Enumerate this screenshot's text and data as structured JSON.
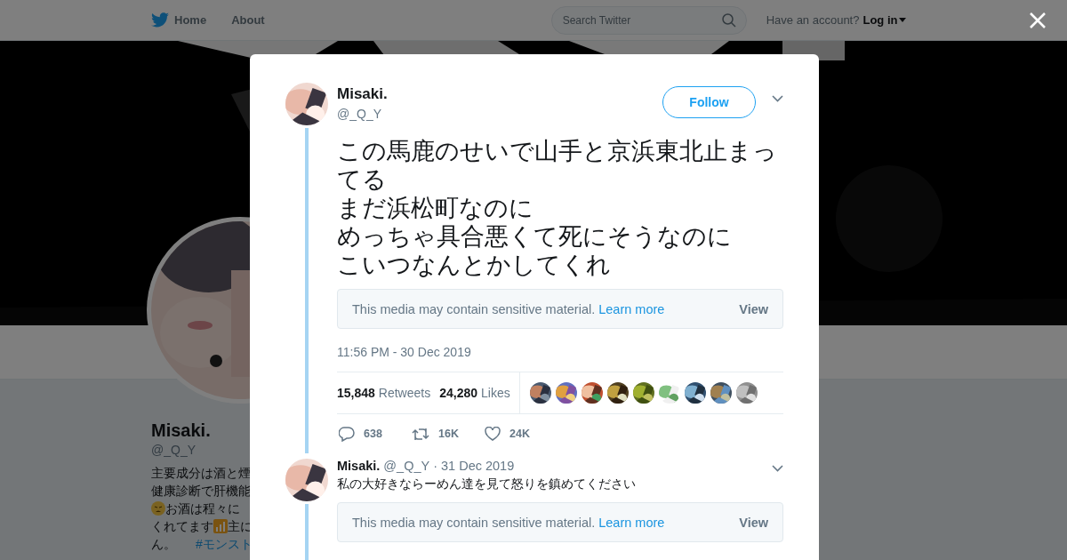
{
  "background": {
    "nav": {
      "items": [
        {
          "label": "Home",
          "kind": "bird"
        },
        {
          "label": "About",
          "kind": "plain"
        }
      ],
      "search": {
        "placeholder": "Search Twitter"
      },
      "account_prompt": "Have an account?",
      "login": "Log in"
    },
    "profile": {
      "name": "Misaki.",
      "handle": "@_Q_Y",
      "bio": [
        [
          {
            "kind": "text",
            "text": "主要成分は酒と煙"
          }
        ],
        [
          {
            "kind": "text",
            "text": "健康診断で肝機能"
          }
        ],
        [
          {
            "kind": "face"
          },
          {
            "kind": "text",
            "text": " お酒は程々に"
          }
        ],
        [
          {
            "kind": "text",
            "text": "くれてます"
          },
          {
            "kind": "bars"
          },
          {
            "kind": "text",
            "text": "主に"
          }
        ],
        [
          {
            "kind": "text",
            "text": "ん。"
          },
          {
            "kind": "link",
            "text": "#モンスト"
          }
        ]
      ]
    }
  },
  "dialog": {
    "tweet": {
      "name": "Misaki.",
      "handle": "@_Q_Y",
      "follow": "Follow",
      "lines": [
        "この馬鹿のせいで山手と京浜東北止まってる",
        "まだ浜松町なのに",
        "めっちゃ具合悪くて死にそうなのに",
        "こいつなんとかしてくれ"
      ],
      "media_notice": {
        "text": "This media may contain sensitive material.",
        "link": "Learn more",
        "button": "View"
      },
      "time": "11:56 PM - 30 Dec 2019",
      "stats": [
        {
          "count": "15,848",
          "label": "Retweets"
        },
        {
          "count": "24,280",
          "label": "Likes"
        }
      ],
      "likers": [
        {
          "kind": "picture"
        },
        {
          "kind": "picture"
        },
        {
          "kind": "picture"
        },
        {
          "kind": "picture"
        },
        {
          "kind": "picture"
        },
        {
          "kind": "picture"
        },
        {
          "kind": "picture"
        },
        {
          "kind": "picture"
        },
        {
          "kind": "picture"
        }
      ],
      "actions": [
        {
          "kind": "reply",
          "count": "638"
        },
        {
          "kind": "retweet",
          "count": "16K"
        },
        {
          "kind": "like",
          "count": "24K"
        }
      ]
    },
    "reply": {
      "name": "Misaki.",
      "handle": "@_Q_Y",
      "separator": "·",
      "date": "31 Dec 2019",
      "text": "私の大好きならーめん達を見て怒りを鎮めてください",
      "media_notice": {
        "text": "This media may contain sensitive material.",
        "link": "Learn more",
        "button": "View"
      }
    }
  }
}
